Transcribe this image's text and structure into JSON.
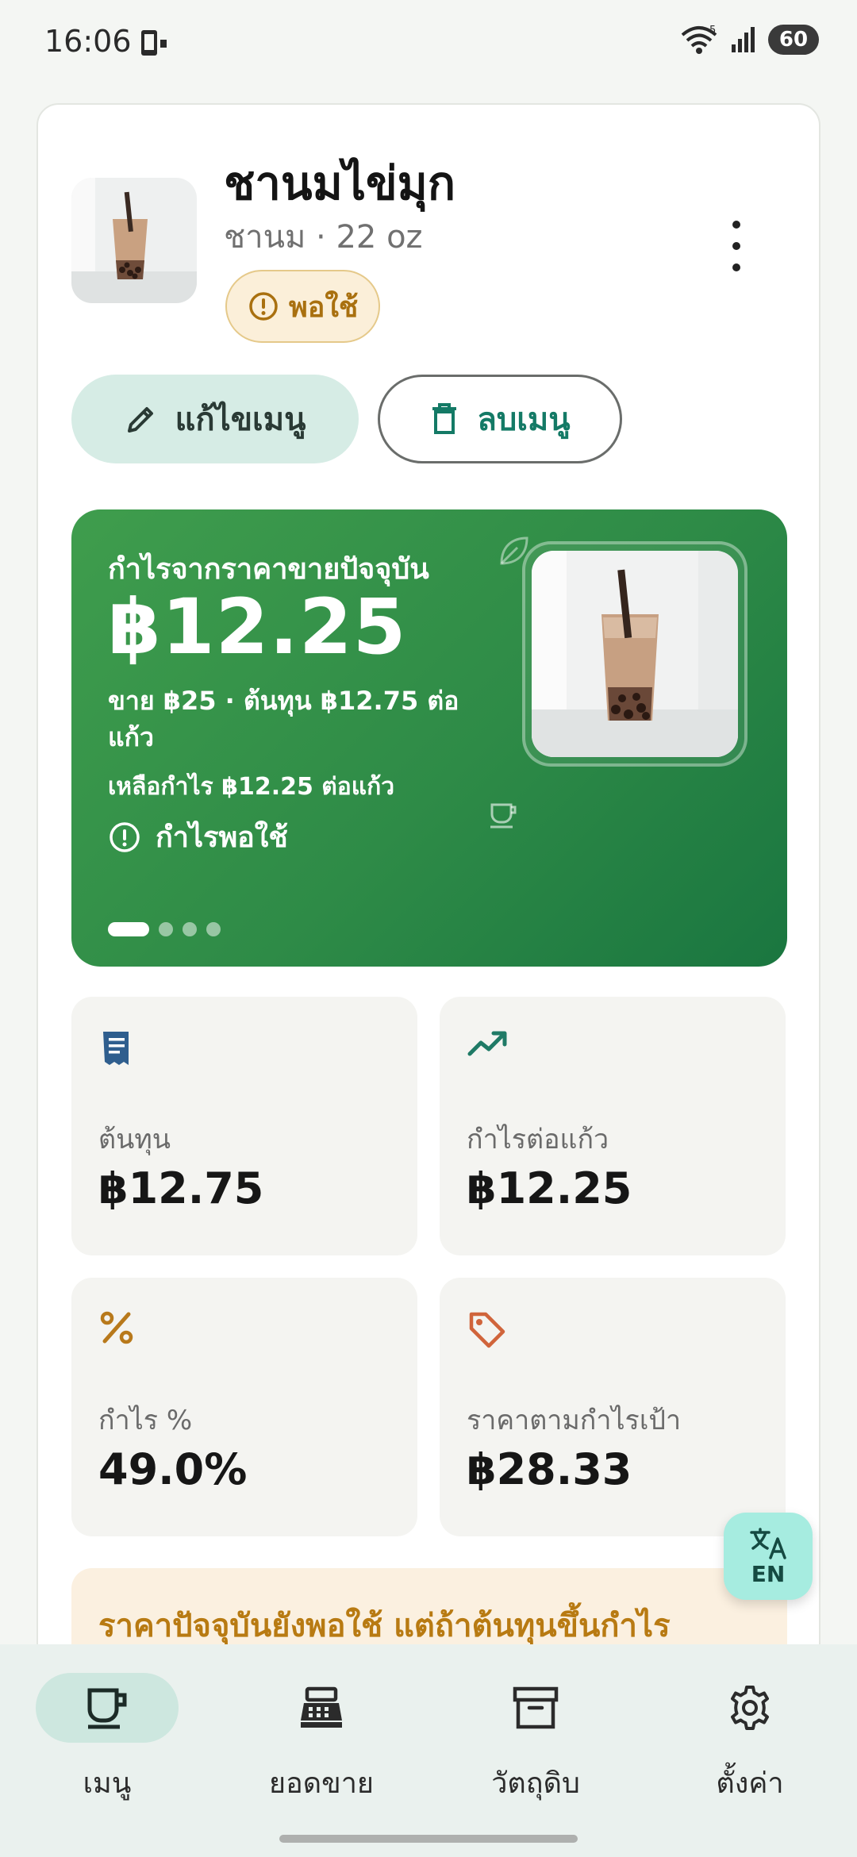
{
  "status_bar": {
    "time": "16:06",
    "battery": "60",
    "wifi_badge": "5"
  },
  "header": {
    "title": "ชานมไข่มุก",
    "subtitle": "ชานม · 22 oz",
    "status_chip": "พอใช้",
    "edit_label": "แก้ไขเมนู",
    "delete_label": "ลบเมนู"
  },
  "profit_card": {
    "heading": "กำไรจากราคาขายปัจจุบัน",
    "amount": "฿12.25",
    "detail": "ขาย ฿25 · ต้นทุน ฿12.75 ต่อแก้ว",
    "remaining": "เหลือกำไร ฿12.25 ต่อแก้ว",
    "status": "กำไรพอใช้",
    "page_count": 4,
    "active_page": 1
  },
  "stats": [
    {
      "label": "ต้นทุน",
      "value": "฿12.75",
      "icon": "receipt-icon",
      "color": "#2f5e8e"
    },
    {
      "label": "กำไรต่อแก้ว",
      "value": "฿12.25",
      "icon": "trending-up-icon",
      "color": "#1f7a66"
    },
    {
      "label": "กำไร %",
      "value": "49.0%",
      "icon": "percent-icon",
      "color": "#b8791b"
    },
    {
      "label": "ราคาตามกำไรเป้า",
      "value": "฿28.33",
      "icon": "tag-icon",
      "color": "#d0643b"
    }
  ],
  "warning": {
    "text": "ราคาปัจจุบันยังพอใช้ แต่ถ้าต้นทุนขึ้นกำไร"
  },
  "language_button": {
    "label": "EN"
  },
  "bottom_nav": [
    {
      "label": "เมนู",
      "icon": "cup-icon",
      "active": true
    },
    {
      "label": "ยอดขาย",
      "icon": "cash-register-icon",
      "active": false
    },
    {
      "label": "วัตถุดิบ",
      "icon": "archive-icon",
      "active": false
    },
    {
      "label": "ตั้งค่า",
      "icon": "gear-icon",
      "active": false
    }
  ],
  "colors": {
    "accent": "#147a66",
    "card_green": "#2e8b47",
    "warning": "#b87a12"
  }
}
